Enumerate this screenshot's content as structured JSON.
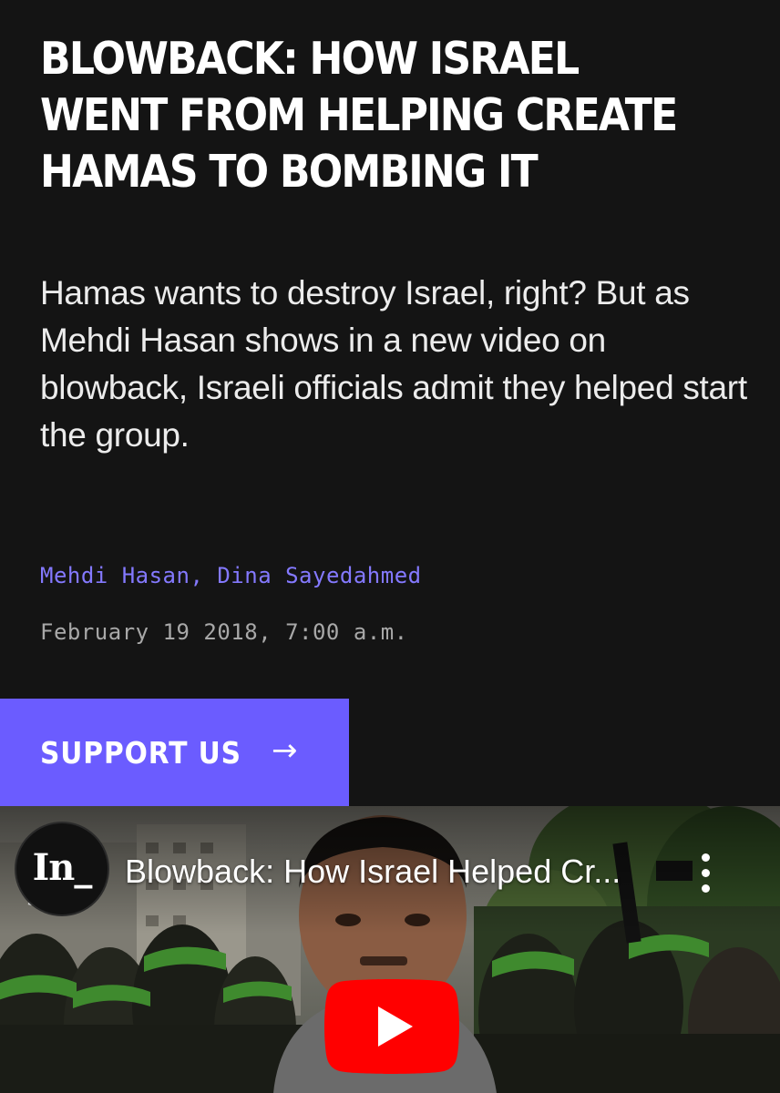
{
  "article": {
    "headline": "BLOWBACK: HOW ISRAEL WENT FROM HELPING CREATE HAMAS TO BOMBING IT",
    "dek": "Hamas wants to destroy Israel, right? But as Mehdi Hasan shows in a new video on blowback, Israeli officials admit they helped start the group.",
    "authors": [
      {
        "name": "Mehdi Hasan"
      },
      {
        "name": "Dina Sayedahmed"
      }
    ],
    "author_separator": ", ",
    "date": "February 19 2018, 7:00 a.m."
  },
  "support": {
    "label": "SUPPORT US",
    "arrow": "→"
  },
  "video": {
    "channel_logo_text": "In_",
    "title": "Blowback: How Israel Helped Cr...",
    "more_icon": "more-vertical-icon",
    "play_icon": "youtube-play-icon"
  },
  "colors": {
    "background": "#141414",
    "accent": "#6b5cff",
    "author_link": "#8479ff",
    "youtube_red": "#ff0000"
  }
}
